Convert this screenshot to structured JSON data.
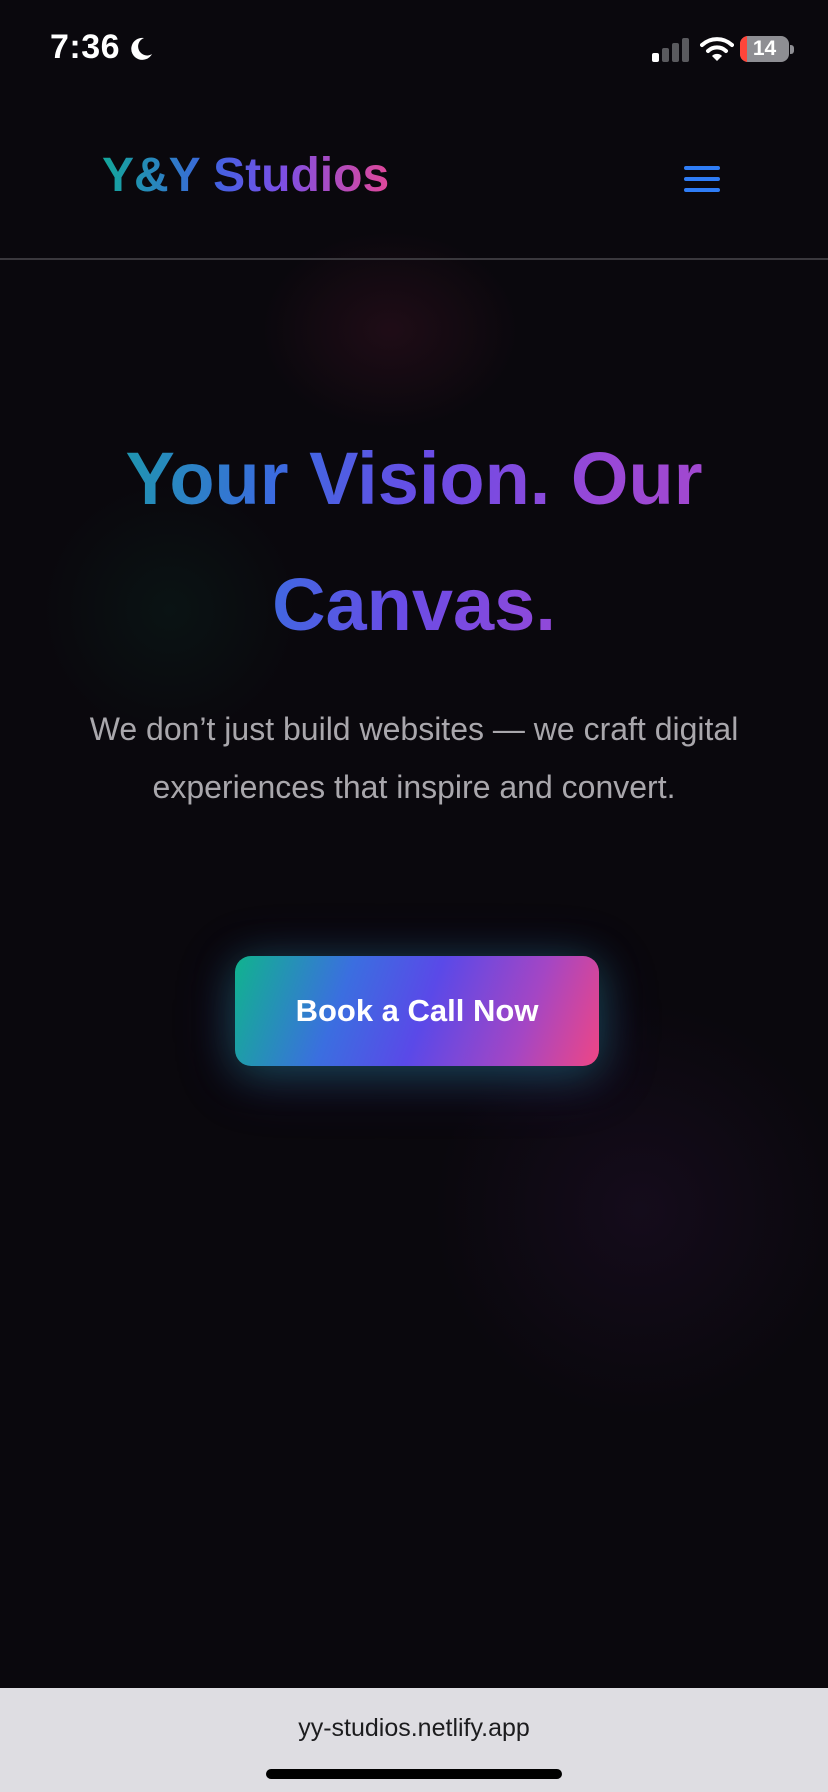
{
  "status_bar": {
    "time": "7:36",
    "battery_level": "14",
    "battery_fraction": 0.14,
    "icons": [
      "moon-icon",
      "signal-icon",
      "wifi-icon",
      "battery-icon"
    ]
  },
  "nav": {
    "brand": "Y&Y Studios",
    "menu_icon": "hamburger-menu-icon"
  },
  "hero": {
    "title": "Your Vision. Our Canvas.",
    "subtitle": "We don’t just build websites — we craft digital experiences that inspire and convert.",
    "cta_label": "Book a Call Now"
  },
  "browser": {
    "url": "yy-studios.netlify.app"
  },
  "colors": {
    "background": "#0a080d",
    "brand_teal": "#13a79a",
    "brand_blue": "#3e63e0",
    "brand_purple": "#7a4fe6",
    "brand_pink": "#e0489a",
    "menu_icon": "#2f7df6",
    "subtitle_text": "#a9a7ac",
    "battery_low": "#ff453a",
    "url_bar": "#dedde2"
  }
}
